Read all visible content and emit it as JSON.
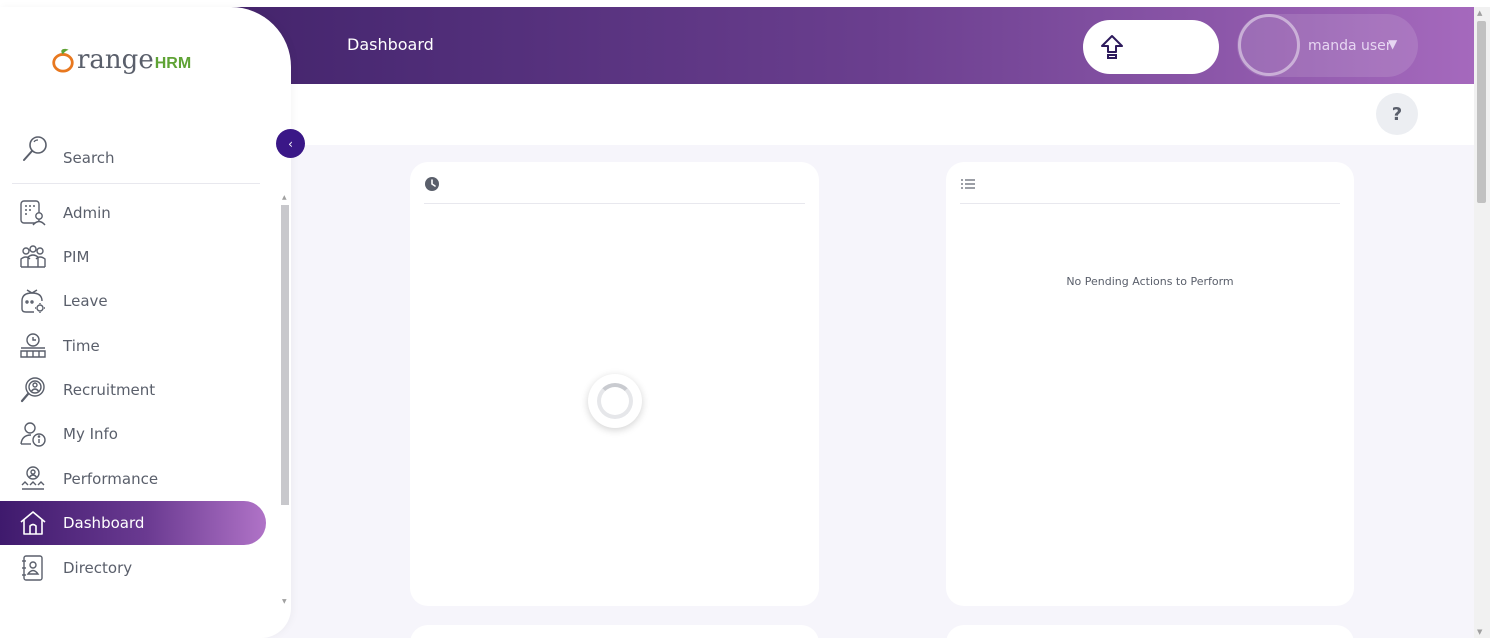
{
  "header": {
    "title": "Dashboard",
    "user_name": "manda user"
  },
  "help": {
    "label": "?"
  },
  "sidebar": {
    "brand_text": "range",
    "brand_hrm": "HRM",
    "search_label": "Search",
    "items": [
      {
        "label": "Admin",
        "icon": "admin-icon"
      },
      {
        "label": "PIM",
        "icon": "pim-icon"
      },
      {
        "label": "Leave",
        "icon": "leave-icon"
      },
      {
        "label": "Time",
        "icon": "time-icon"
      },
      {
        "label": "Recruitment",
        "icon": "recruitment-icon"
      },
      {
        "label": "My Info",
        "icon": "my-info-icon"
      },
      {
        "label": "Performance",
        "icon": "performance-icon"
      },
      {
        "label": "Dashboard",
        "icon": "home-icon",
        "active": true
      },
      {
        "label": "Directory",
        "icon": "directory-icon"
      }
    ]
  },
  "widgets": {
    "pending_actions_message": "No Pending Actions to Perform"
  },
  "colors": {
    "accent": "#3a1787",
    "header_start": "#3a1b5e",
    "header_end": "#a569bd",
    "brand_green": "#5fa335",
    "brand_orange": "#e8781f"
  }
}
